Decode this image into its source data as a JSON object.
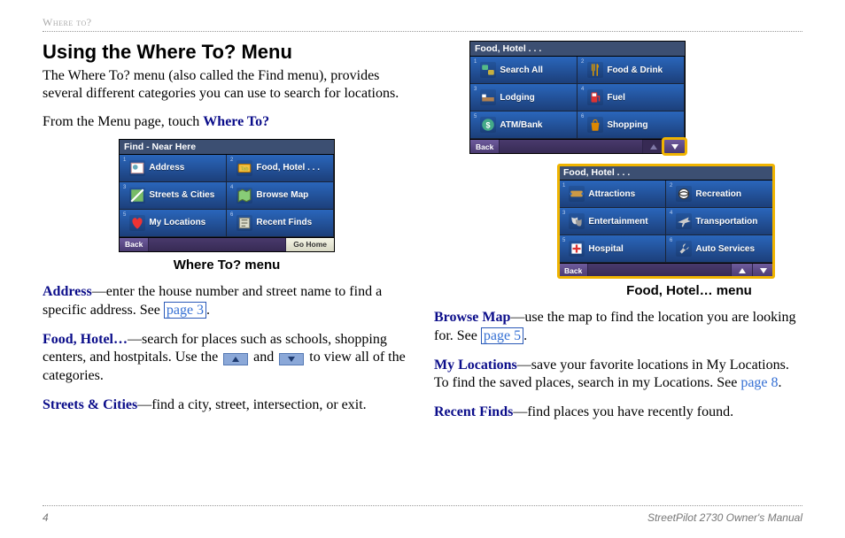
{
  "header": {
    "section": "Where to?"
  },
  "heading": "Using the Where To? Menu",
  "intro": "The Where To? menu (also called the Find menu), provides several different categories you can use to search for locations.",
  "lead_prefix": "From the Menu page, touch ",
  "lead_bold": "Where To?",
  "where_caption": "Where To? menu",
  "food_caption": "Food, Hotel… menu",
  "left_items": {
    "address": {
      "term": "Address",
      "t1": "—enter the house number and street name to find a specific address. See ",
      "link": "page 3",
      "t2": "."
    },
    "food": {
      "term": "Food, Hotel…",
      "t1": "—search for places such as schools, shopping centers, and hostpitals. Use the ",
      "t2": " and ",
      "t3": " to view all of the categories."
    },
    "streets": {
      "term": "Streets & Cities",
      "t1": "—find a city, street, intersection, or exit."
    }
  },
  "right_items": {
    "browse": {
      "term": "Browse Map",
      "t1": "—use the map to find the location you are looking for. See ",
      "link": "page 5",
      "t2": "."
    },
    "mylocs": {
      "term": "My Locations",
      "t1": "—save your favorite locations in My Locations. To find the saved places, search in my Locations. See ",
      "link": "page 8",
      "t2": "."
    },
    "recent": {
      "term": "Recent Finds",
      "t1": "—find places you have recently found."
    }
  },
  "device_where": {
    "title": "Find - Near Here",
    "cells": [
      {
        "n": "1",
        "label": "Address",
        "icon": "address"
      },
      {
        "n": "2",
        "label": "Food, Hotel . . .",
        "icon": "food"
      },
      {
        "n": "3",
        "label": "Streets & Cities",
        "icon": "streets"
      },
      {
        "n": "4",
        "label": "Browse Map",
        "icon": "map"
      },
      {
        "n": "5",
        "label": "My Locations",
        "icon": "heart"
      },
      {
        "n": "6",
        "label": "Recent Finds",
        "icon": "recent"
      }
    ],
    "back": "Back",
    "gohome": "Go Home"
  },
  "device_food1": {
    "title": "Food, Hotel . . .",
    "cells": [
      {
        "n": "1",
        "label": "Search All",
        "icon": "abc"
      },
      {
        "n": "2",
        "label": "Food & Drink",
        "icon": "fork"
      },
      {
        "n": "3",
        "label": "Lodging",
        "icon": "bed"
      },
      {
        "n": "4",
        "label": "Fuel",
        "icon": "fuel"
      },
      {
        "n": "5",
        "label": "ATM/Bank",
        "icon": "dollar"
      },
      {
        "n": "6",
        "label": "Shopping",
        "icon": "bag"
      }
    ],
    "back": "Back"
  },
  "device_food2": {
    "title": "Food, Hotel . . .",
    "cells": [
      {
        "n": "1",
        "label": "Attractions",
        "icon": "ticket"
      },
      {
        "n": "2",
        "label": "Recreation",
        "icon": "ball"
      },
      {
        "n": "3",
        "label": "Entertainment",
        "icon": "masks"
      },
      {
        "n": "4",
        "label": "Transportation",
        "icon": "plane"
      },
      {
        "n": "5",
        "label": "Hospital",
        "icon": "hospital"
      },
      {
        "n": "6",
        "label": "Auto Services",
        "icon": "wrench"
      }
    ],
    "back": "Back"
  },
  "footer": {
    "page": "4",
    "doc": "StreetPilot 2730 Owner's Manual"
  }
}
